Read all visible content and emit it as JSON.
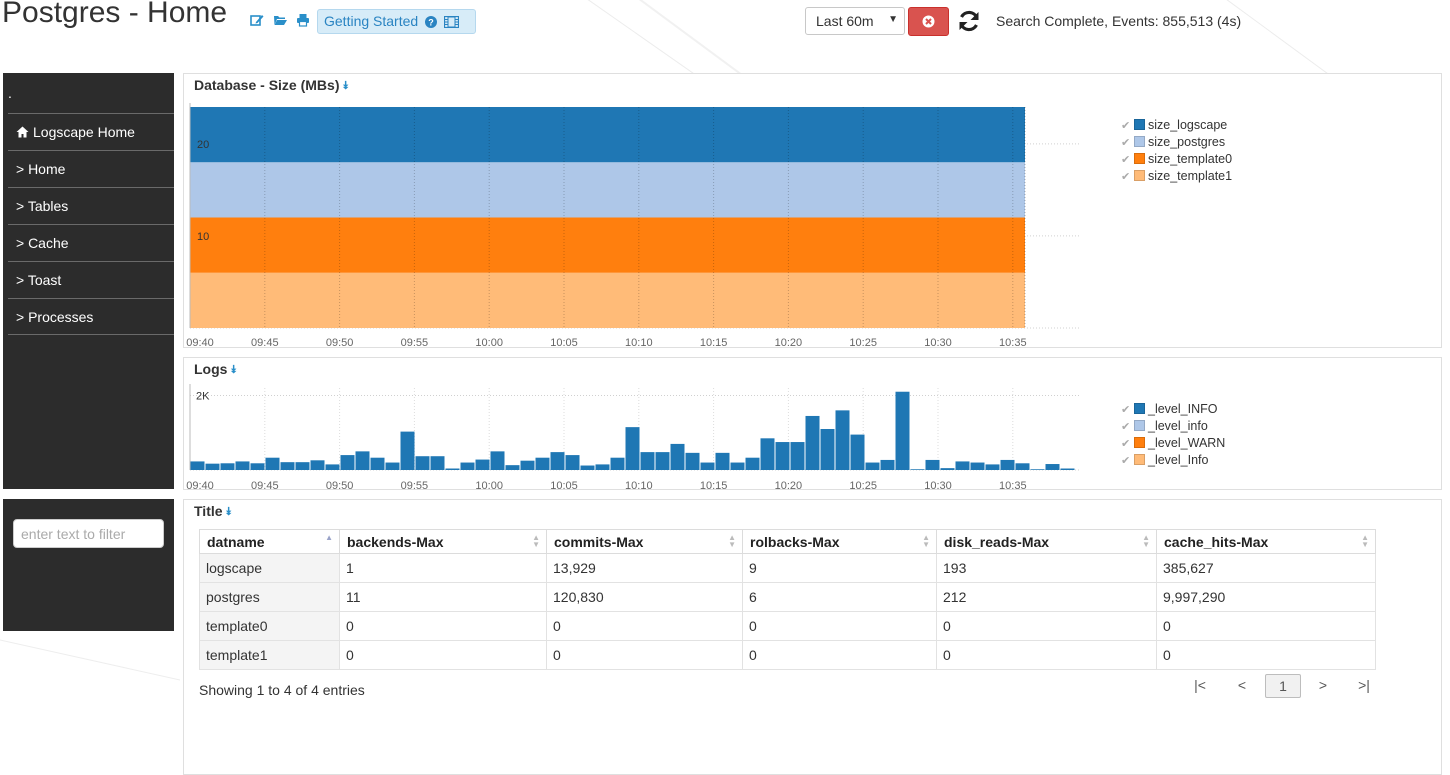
{
  "header": {
    "title": "Postgres - Home",
    "getting_started_label": "Getting Started",
    "time_range": "Last 60m",
    "status": "Search Complete, Events: 855,513 (4s)",
    "icons": [
      "edit-icon",
      "folder-open-icon",
      "print-icon",
      "question-icon",
      "film-icon",
      "stop-icon",
      "refresh-icon"
    ]
  },
  "sidebar": {
    "marker": ".",
    "items": [
      {
        "label": "Logscape Home",
        "icon": "home-icon"
      },
      {
        "label": "> Home"
      },
      {
        "label": "> Tables"
      },
      {
        "label": "> Cache"
      },
      {
        "label": "> Toast"
      },
      {
        "label": "> Processes"
      }
    ]
  },
  "filter": {
    "placeholder": "enter text to filter"
  },
  "panels": {
    "db_size": {
      "title": "Database - Size (MBs)"
    },
    "logs": {
      "title": "Logs"
    },
    "table": {
      "title": "Title"
    }
  },
  "chart_data": [
    {
      "type": "area",
      "title": "Database - Size (MBs)",
      "stacked": true,
      "x": [
        "09:40",
        "09:45",
        "09:50",
        "09:55",
        "10:00",
        "10:05",
        "10:10",
        "10:15",
        "10:20",
        "10:25",
        "10:30",
        "10:35"
      ],
      "x_end": "10:35",
      "yticks": [
        "10",
        "20"
      ],
      "ylim": [
        0,
        24
      ],
      "grid": true,
      "legend_position": "right",
      "series": [
        {
          "name": "size_logscape",
          "color": "#1f77b4",
          "value": 6
        },
        {
          "name": "size_postgres",
          "color": "#aec7e8",
          "value": 6
        },
        {
          "name": "size_template0",
          "color": "#ff7f0e",
          "value": 6
        },
        {
          "name": "size_template1",
          "color": "#ffbb78",
          "value": 6
        }
      ]
    },
    {
      "type": "bar",
      "title": "Logs",
      "x": [
        "09:40",
        "09:45",
        "09:50",
        "09:55",
        "10:00",
        "10:05",
        "10:10",
        "10:15",
        "10:20",
        "10:25",
        "10:30",
        "10:35"
      ],
      "yticks": [
        "2K"
      ],
      "ylim": [
        0,
        2200
      ],
      "grid": true,
      "legend_position": "right",
      "series": [
        {
          "name": "_level_INFO",
          "color": "#1f77b4",
          "values": [
            230,
            170,
            180,
            230,
            180,
            330,
            210,
            210,
            260,
            150,
            400,
            500,
            330,
            200,
            1030,
            370,
            370,
            40,
            200,
            280,
            500,
            130,
            250,
            330,
            480,
            400,
            120,
            150,
            330,
            1150,
            480,
            480,
            700,
            460,
            200,
            460,
            200,
            330,
            850,
            750,
            750,
            1450,
            1100,
            1600,
            950,
            200,
            270,
            2100,
            20,
            270,
            50,
            230,
            200,
            150,
            270,
            180,
            20,
            160,
            40
          ]
        },
        {
          "name": "_level_info",
          "color": "#aec7e8",
          "values": []
        },
        {
          "name": "_level_WARN",
          "color": "#ff7f0e",
          "values": []
        },
        {
          "name": "_level_Info",
          "color": "#ffbb78",
          "values": []
        }
      ]
    }
  ],
  "table": {
    "columns": [
      "datname",
      "backends-Max",
      "commits-Max",
      "rolbacks-Max",
      "disk_reads-Max",
      "cache_hits-Max"
    ],
    "rows": [
      [
        "logscape",
        "1",
        "13,929",
        "9",
        "193",
        "385,627"
      ],
      [
        "postgres",
        "11",
        "120,830",
        "6",
        "212",
        "9,997,290"
      ],
      [
        "template0",
        "0",
        "0",
        "0",
        "0",
        "0"
      ],
      [
        "template1",
        "0",
        "0",
        "0",
        "0",
        "0"
      ]
    ],
    "info": "Showing 1 to 4 of 4 entries",
    "pager": {
      "first": "|<",
      "prev": "<",
      "current": "1",
      "next": ">",
      "last": ">|"
    }
  },
  "colors": {
    "accent": "#2a8fc9",
    "sidebar_bg": "#2c2c2c",
    "stop_button": "#d9534f",
    "gs_bg": "#d7ecf8"
  }
}
